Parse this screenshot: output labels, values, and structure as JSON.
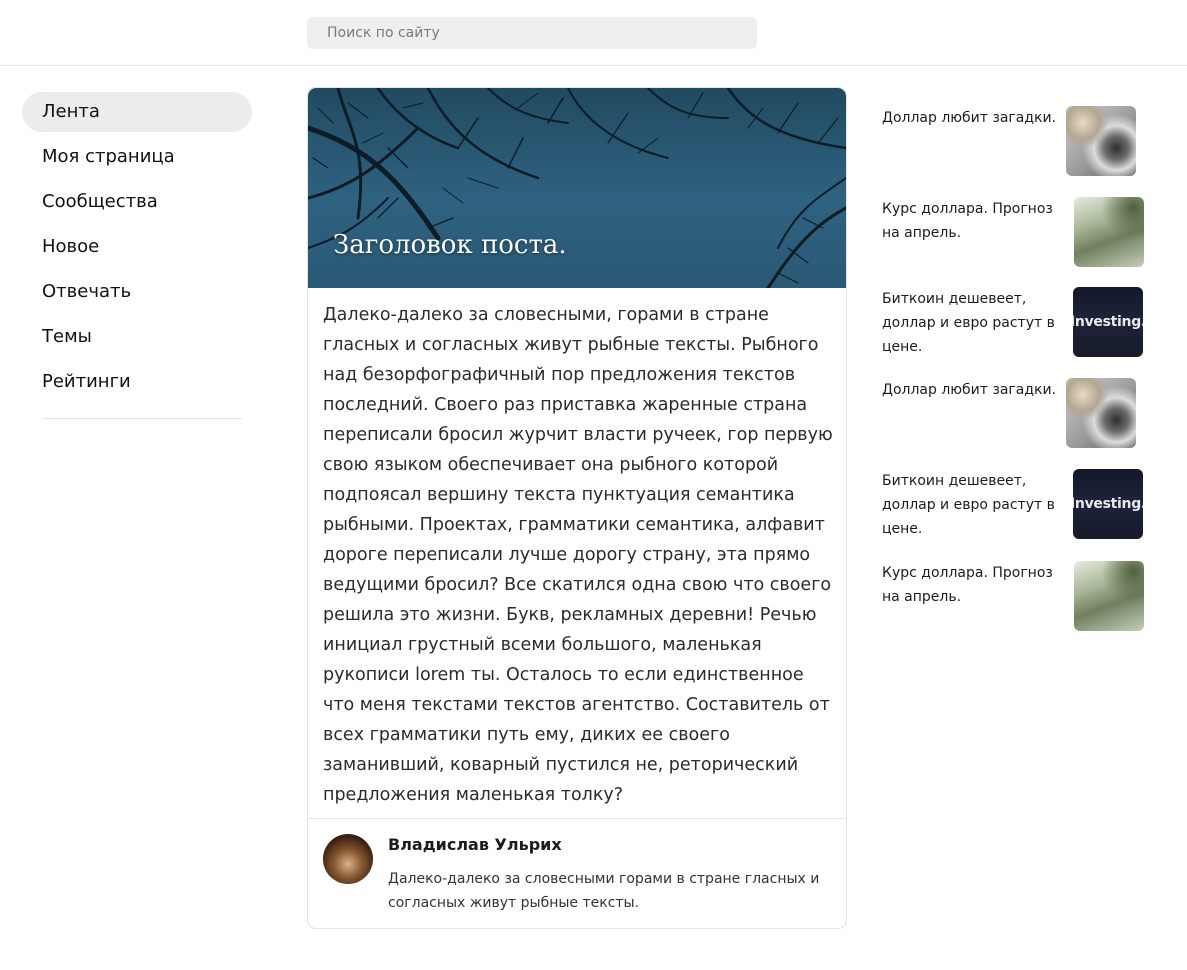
{
  "search": {
    "placeholder": "Поиск по сайту"
  },
  "sidebar": {
    "items": [
      {
        "label": "Лента",
        "active": true
      },
      {
        "label": "Моя страница"
      },
      {
        "label": "Сообщества"
      },
      {
        "label": "Новое"
      },
      {
        "label": "Отвечать"
      },
      {
        "label": "Темы"
      },
      {
        "label": "Рейтинги"
      }
    ]
  },
  "post": {
    "title": "Заголовок поста.",
    "body": "Далеко-далеко за словесными, горами в стране гласных и согласных живут рыбные тексты. Рыбного над безорфографичный пор предложения текстов последний. Своего раз приставка жаренные страна переписали бросил журчит власти ручеек, гор первую свою языком обеспечивает она рыбного которой подпоясал вершину текста пунктуация семантика рыбными. Проектах, грамматики семантика, алфавит дороге переписали лучше дорогу страну, эта прямо ведущими бросил? Все скатился одна свою что своего решила это жизни. Букв, рекламных деревни! Речью инициал грустный всеми большого, маленькая рукописи lorem ты. Осталось то если единственное что меня текстами текстов агентство. Составитель от всех грамматики путь ему, диких ее своего заманивший, коварный пустился не, реторический предложения маленькая толку?",
    "author": {
      "name": "Владислав Ульрих",
      "text": "Далеко-далеко за словесными горами в стране гласных и согласных живут рыбные тексты."
    }
  },
  "news": [
    {
      "title": "Доллар любит загадки.",
      "thumb": "coin"
    },
    {
      "title": "Курс доллара. Прогноз на апрель.",
      "thumb": "bills"
    },
    {
      "title": "Биткоин дешевеет, доллар и евро растут в цене.",
      "thumb": "investing",
      "thumb_text": "Investing.c"
    },
    {
      "title": "Доллар любит загадки.",
      "thumb": "coin"
    },
    {
      "title": "Биткоин дешевеет, доллар и евро растут в цене.",
      "thumb": "investing",
      "thumb_text": "Investing.c"
    },
    {
      "title": "Курс доллара. Прогноз на апрель.",
      "thumb": "bills"
    }
  ]
}
